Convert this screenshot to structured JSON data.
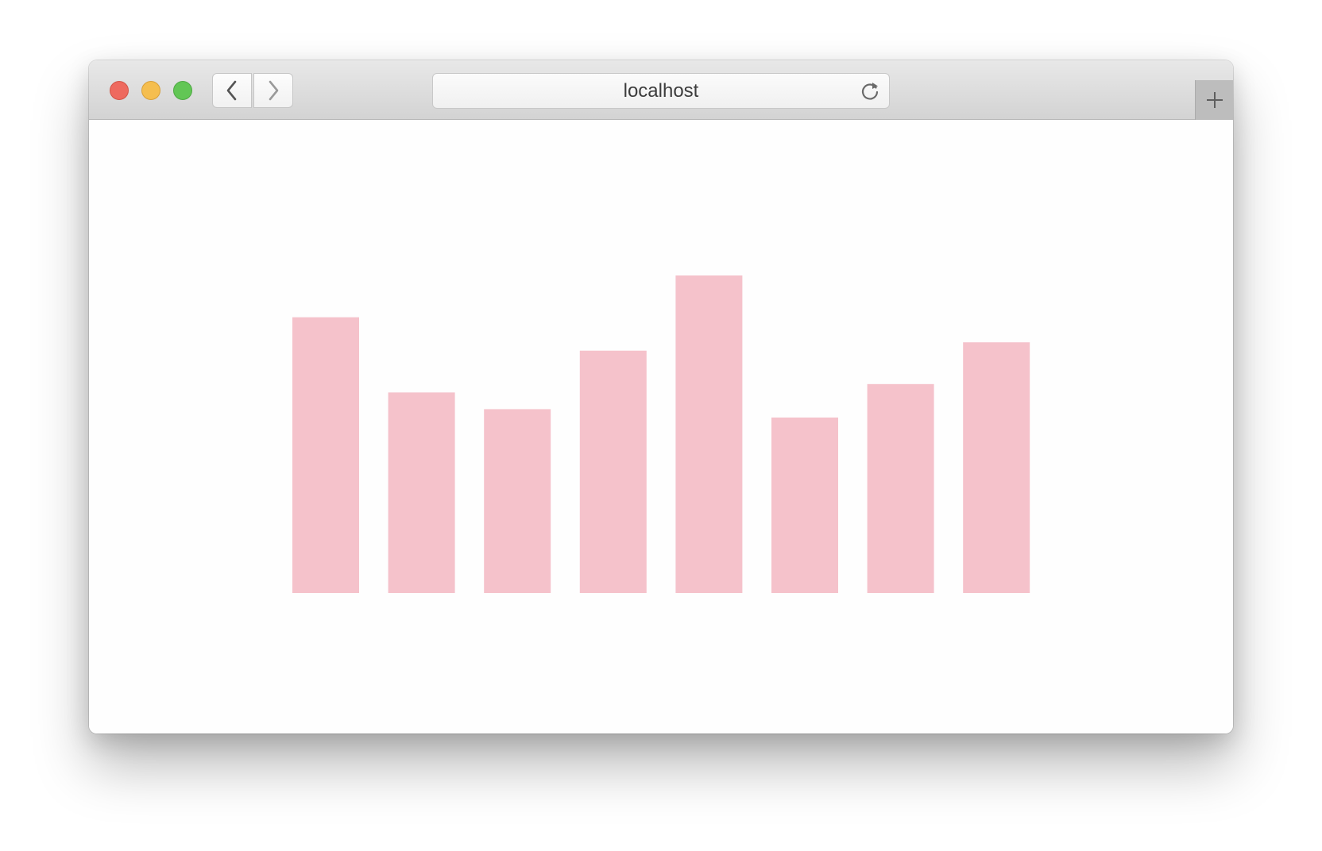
{
  "browser": {
    "address": "localhost",
    "icons": {
      "close": "close-dot",
      "minimize": "minimize-dot",
      "maximize": "maximize-dot",
      "back": "chevron-left-icon",
      "forward": "chevron-right-icon",
      "reload": "reload-icon",
      "new_tab": "plus-icon"
    },
    "colors": {
      "close": "#ee6a5f",
      "minimize": "#f5be4f",
      "maximize": "#62c655"
    }
  },
  "chart_data": {
    "type": "bar",
    "categories": [
      "",
      "",
      "",
      "",
      "",
      "",
      "",
      ""
    ],
    "values": [
      33,
      24,
      22,
      29,
      38,
      21,
      25,
      30
    ],
    "ylim": [
      0,
      38
    ],
    "bar_color": "#f5c2cb",
    "grid": false,
    "axes_visible": false,
    "title": "",
    "xlabel": "",
    "ylabel": ""
  }
}
